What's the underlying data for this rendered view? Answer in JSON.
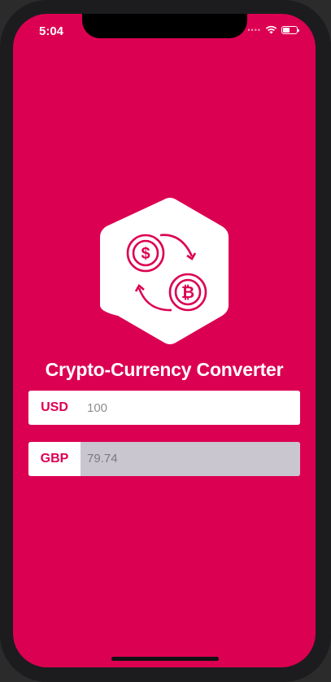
{
  "status_bar": {
    "time": "5:04",
    "signal_icon": "signal-dots-icon",
    "wifi_icon": "wifi-icon",
    "battery_icon": "battery-icon"
  },
  "app": {
    "logo_icon": "crypto-exchange-icon",
    "title": "Crypto-Currency Converter"
  },
  "converter": {
    "from": {
      "code": "USD",
      "value": "100"
    },
    "to": {
      "code": "GBP",
      "value": "79.74"
    }
  },
  "colors": {
    "accent": "#dc0052",
    "field_bg": "#ffffff",
    "readonly_bg": "#c9c6d0"
  }
}
